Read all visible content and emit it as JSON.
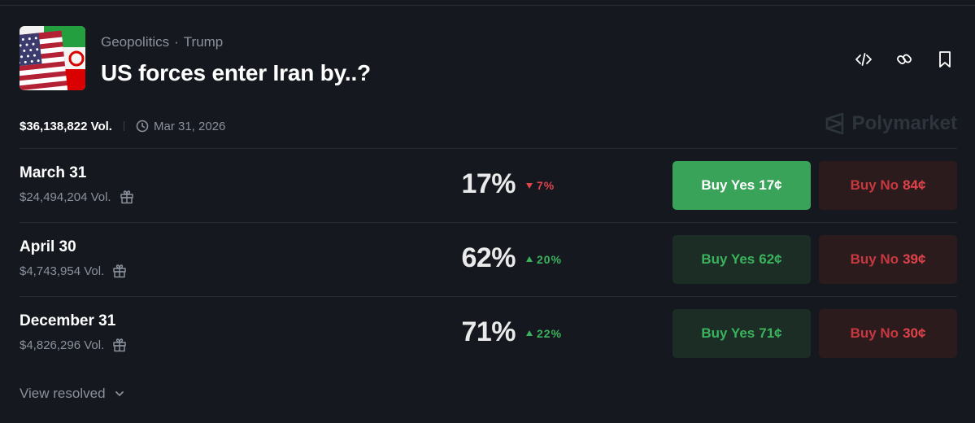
{
  "breadcrumb": {
    "category": "Geopolitics",
    "separator": "·",
    "tag": "Trump"
  },
  "market": {
    "title": "US forces enter Iran by..?",
    "volume": "$36,138,822 Vol.",
    "end_date": "Mar 31, 2026"
  },
  "brand": {
    "name": "Polymarket"
  },
  "icons": {
    "embed": "code-icon",
    "link": "link-icon",
    "bookmark": "bookmark-icon",
    "clock": "clock-icon",
    "gift": "gift-icon",
    "chevron": "chevron-down-icon"
  },
  "outcomes": [
    {
      "label": "March 31",
      "volume": "$24,494,204 Vol.",
      "probability": "17%",
      "change": "7%",
      "direction": "down",
      "yes_label": "Buy Yes",
      "yes_price": "17¢",
      "no_label": "Buy No",
      "no_price": "84¢"
    },
    {
      "label": "April 30",
      "volume": "$4,743,954 Vol.",
      "probability": "62%",
      "change": "20%",
      "direction": "up",
      "yes_label": "Buy Yes",
      "yes_price": "62¢",
      "no_label": "Buy No",
      "no_price": "39¢"
    },
    {
      "label": "December 31",
      "volume": "$4,826,296 Vol.",
      "probability": "71%",
      "change": "22%",
      "direction": "up",
      "yes_label": "Buy Yes",
      "yes_price": "71¢",
      "no_label": "Buy No",
      "no_price": "30¢"
    }
  ],
  "footer": {
    "view_resolved": "View resolved"
  },
  "colors": {
    "background": "#15191f",
    "yes": "#3bb35d",
    "yes_active": "#3aa35a",
    "no": "#e0434b"
  }
}
